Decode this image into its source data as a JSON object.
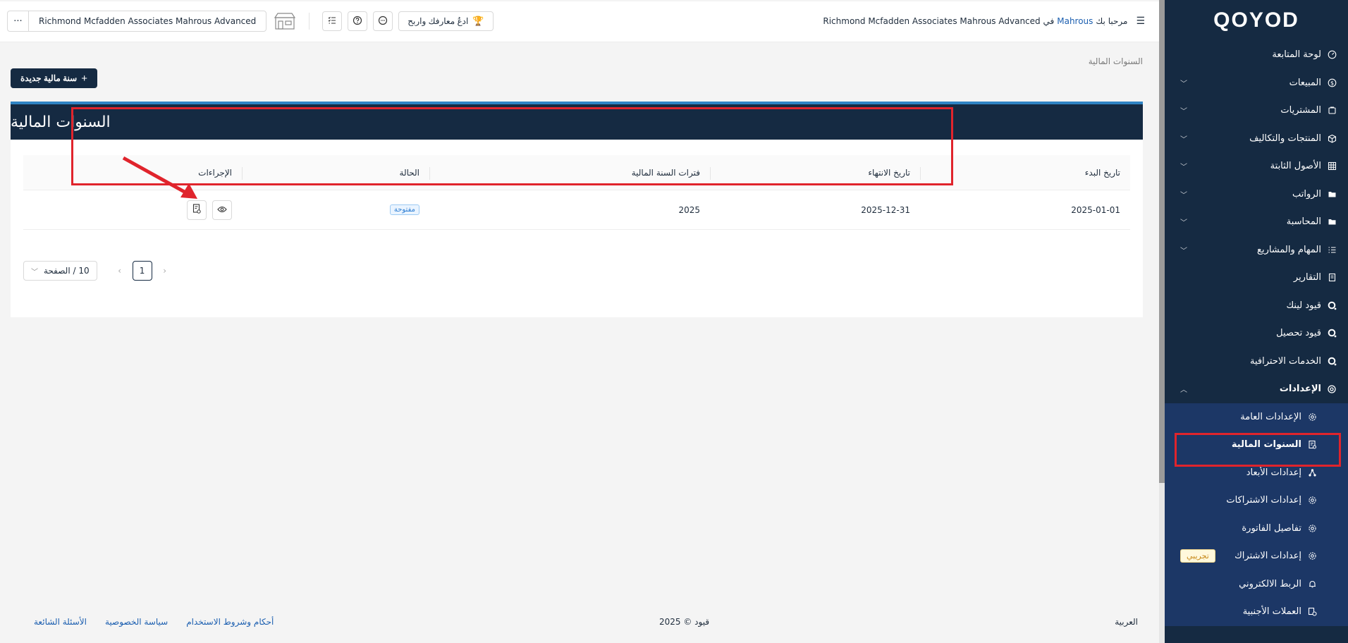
{
  "brand": {
    "prefix": "OO",
    "dot": "Y",
    "suffix": "OD",
    "full": "QOYOD"
  },
  "header": {
    "company_name": "Richmond Mcfadden Associates Mahrous Advanced",
    "more_label": "···",
    "invite_label": "ادعُ معارفك واربح",
    "welcome_prefix": "مرحبا بك",
    "welcome_user": "Mahrous",
    "welcome_in": "في",
    "welcome_company": "Richmond Mcfadden Associates Mahrous Advanced"
  },
  "breadcrumb": "السنوات المالية",
  "new_button": "سنة مالية جديدة",
  "card_title": "السنوات المالية",
  "table": {
    "headers": [
      "تاريخ البدء",
      "تاريخ الانتهاء",
      "فترات السنة المالية",
      "الحالة",
      "الإجراءات"
    ],
    "rows": [
      {
        "start": "2025-01-01",
        "end": "2025-12-31",
        "periods": "2025",
        "status": "مفتوحة"
      }
    ]
  },
  "pager": {
    "page_size": "10 / الصفحة",
    "current": "1",
    "prev": "‹",
    "next": "›"
  },
  "footer": {
    "links": [
      "أحكام وشروط الاستخدام",
      "سياسة الخصوصية",
      "الأسئلة الشائعة"
    ],
    "copyright": "قيود © 2025",
    "language": "العربية"
  },
  "sidebar": {
    "items": [
      {
        "label": "لوحة المتابعة",
        "icon": "dashboard-icon",
        "chevron": false
      },
      {
        "label": "المبيعات",
        "icon": "dollar-icon",
        "chevron": true
      },
      {
        "label": "المشتريات",
        "icon": "cart-icon",
        "chevron": true
      },
      {
        "label": "المنتجات والتكاليف",
        "icon": "box-icon",
        "chevron": true
      },
      {
        "label": "الأصول الثابتة",
        "icon": "grid-icon",
        "chevron": true
      },
      {
        "label": "الرواتب",
        "icon": "folder-icon",
        "chevron": true
      },
      {
        "label": "المحاسبة",
        "icon": "folder-icon",
        "chevron": true
      },
      {
        "label": "المهام والمشاريع",
        "icon": "list-icon",
        "chevron": true
      },
      {
        "label": "التقارير",
        "icon": "report-icon",
        "chevron": false
      },
      {
        "label": "قيود لينك",
        "icon": "qoyod-q-icon",
        "chevron": false
      },
      {
        "label": "قيود تحصيل",
        "icon": "qoyod-q-icon",
        "chevron": false
      },
      {
        "label": "الخدمات الاحترافية",
        "icon": "qoyod-q-icon",
        "chevron": false
      }
    ],
    "settings": {
      "label": "الإعدادات",
      "icon": "gear-icon"
    },
    "sub_items": [
      {
        "label": "الإعدادات العامة",
        "icon": "gear-icon",
        "badge": ""
      },
      {
        "label": "السنوات المالية",
        "icon": "calendar-doc-icon",
        "badge": "",
        "active": true
      },
      {
        "label": "إعدادات الأبعاد",
        "icon": "network-icon",
        "badge": ""
      },
      {
        "label": "إعدادات الاشتراكات",
        "icon": "gear-icon",
        "badge": ""
      },
      {
        "label": "تفاصيل الفاتورة",
        "icon": "gear-icon",
        "badge": ""
      },
      {
        "label": "إعدادات الاشتراك",
        "icon": "gear-icon",
        "badge": "تجريبي"
      },
      {
        "label": "الربط الالكتروني",
        "icon": "bell-icon",
        "badge": ""
      },
      {
        "label": "العملات الأجنبية",
        "icon": "currency-icon",
        "badge": ""
      }
    ]
  },
  "colors": {
    "sidebar": "#152a42",
    "submenu": "#1c3766",
    "accent": "#2f9cf0",
    "highlight": "#e0242c"
  }
}
